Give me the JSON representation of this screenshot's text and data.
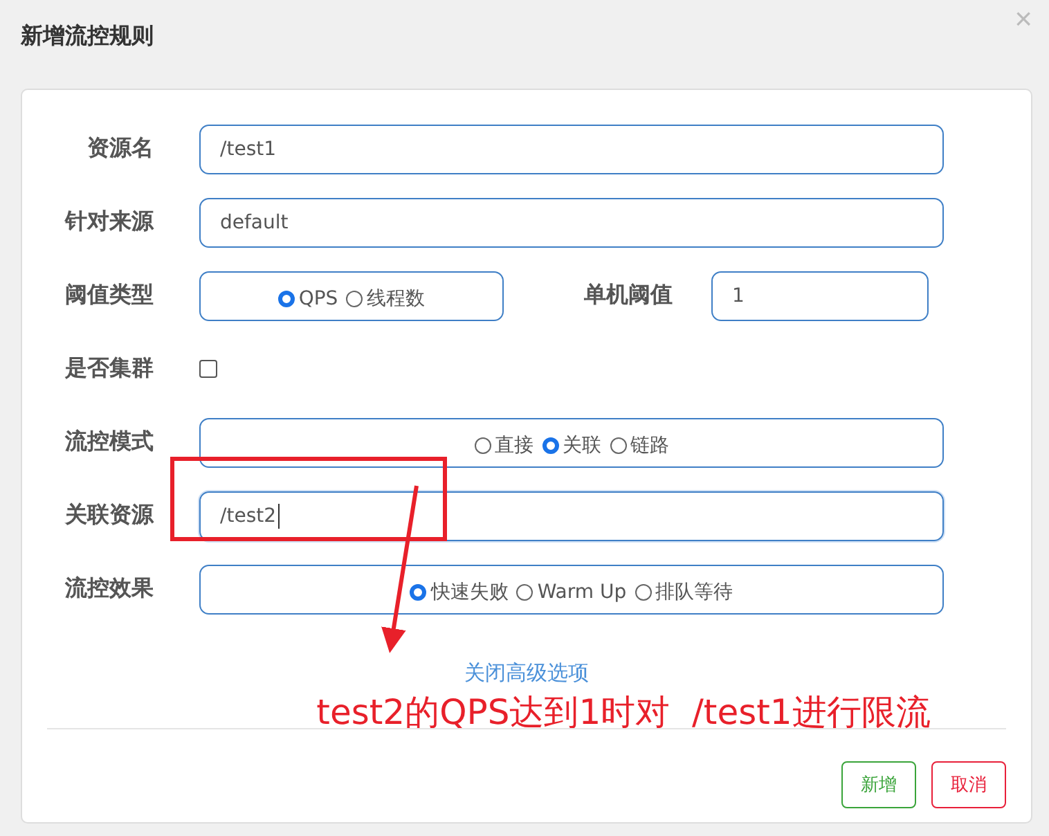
{
  "dialog": {
    "title": "新增流控规则",
    "close": "×"
  },
  "rows": [
    {
      "kind": "text",
      "label": "资源名",
      "value": "/test1",
      "focused": false
    },
    {
      "kind": "text",
      "label": "针对来源",
      "value": "default",
      "focused": false
    },
    {
      "kind": "radio",
      "label": "阈值类型",
      "options": [
        {
          "label": "QPS",
          "selected": true
        },
        {
          "label": "线程数",
          "selected": false
        }
      ],
      "aside": {
        "label": "单机阈值",
        "value": "1"
      }
    },
    {
      "kind": "checkbox",
      "label": "是否集群",
      "checked": false
    },
    {
      "kind": "radio",
      "label": "流控模式",
      "options": [
        {
          "label": "直接",
          "selected": false
        },
        {
          "label": "关联",
          "selected": true
        },
        {
          "label": "链路",
          "selected": false
        }
      ]
    },
    {
      "kind": "text",
      "label": "关联资源",
      "value": "/test2",
      "focused": true
    },
    {
      "kind": "radio",
      "label": "流控效果",
      "options": [
        {
          "label": "快速失败",
          "selected": true
        },
        {
          "label": "Warm Up",
          "selected": false
        },
        {
          "label": "排队等待",
          "selected": false
        }
      ]
    }
  ],
  "advanced_link": "关闭高级选项",
  "annotation": {
    "text": "test2的QPS达到1时对  /test1进行限流"
  },
  "buttons": [
    {
      "label": "新增",
      "kind": "confirm"
    },
    {
      "label": "取消",
      "kind": "cancel"
    }
  ]
}
